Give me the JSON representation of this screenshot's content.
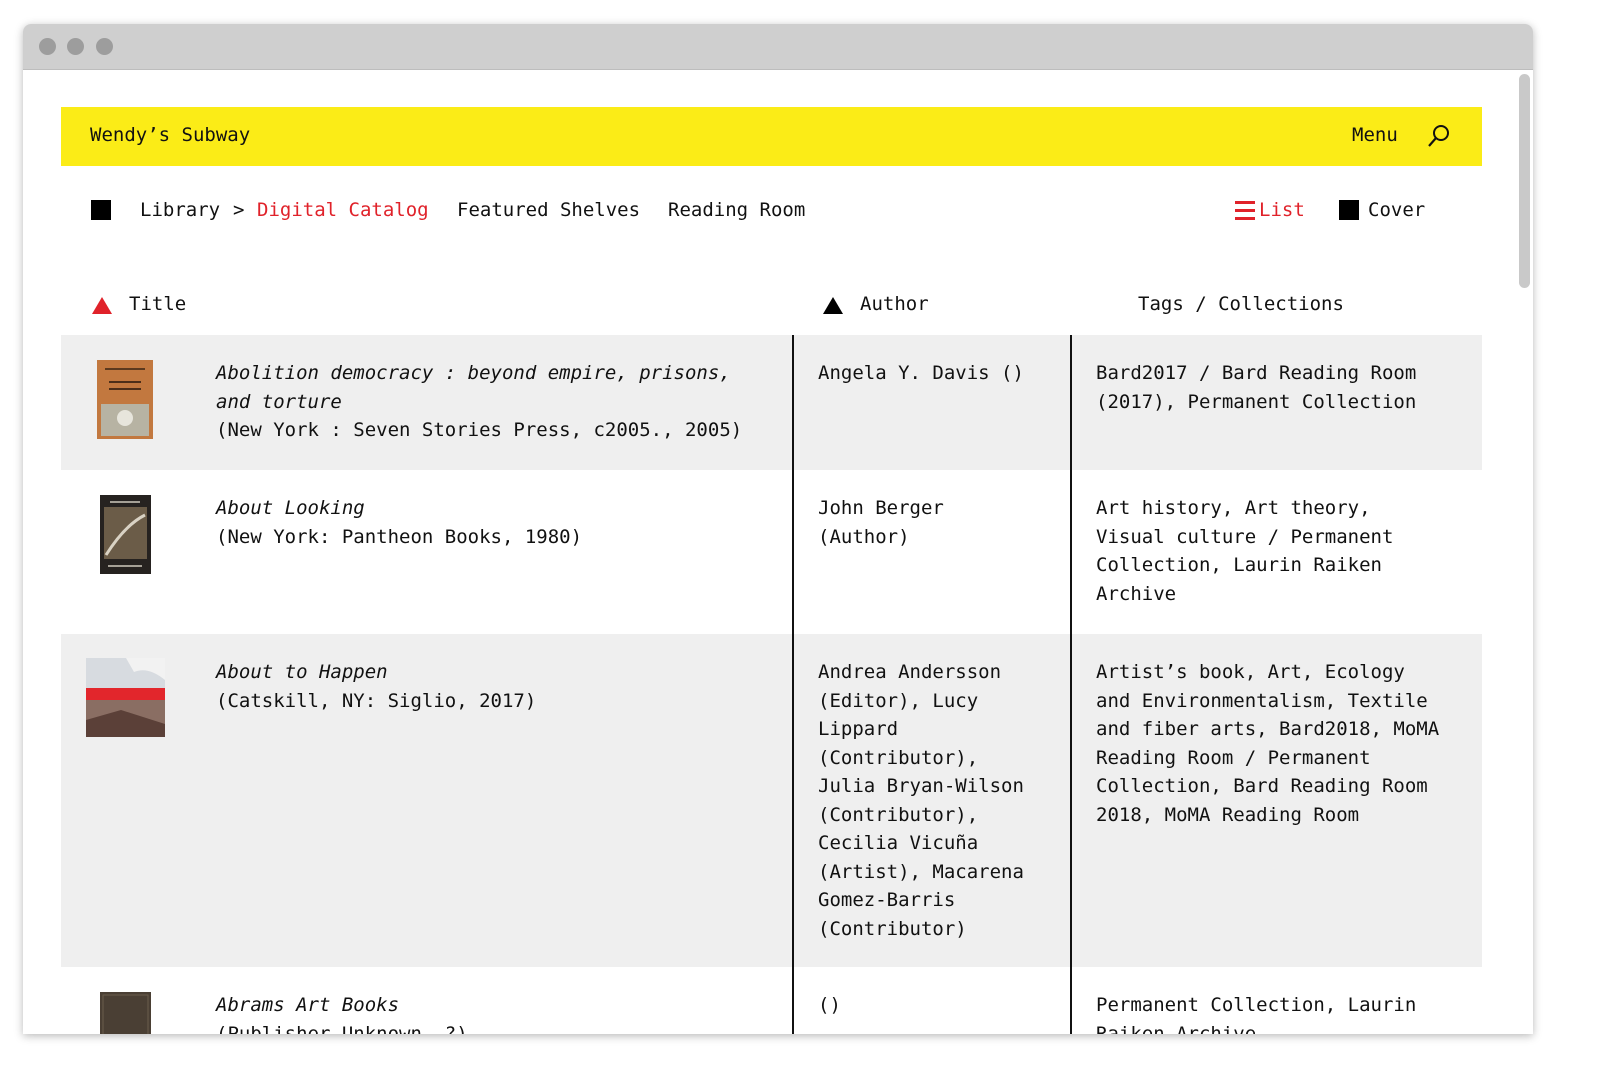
{
  "header": {
    "brand": "Wendy’s Subway",
    "menu_label": "Menu",
    "search_icon": "search-icon",
    "background": "#fbec17"
  },
  "nav": {
    "home_icon": "square-icon",
    "library": "Library",
    "separator": ">",
    "current": "Digital Catalog",
    "featured": "Featured Shelves",
    "reading_room": "Reading Room",
    "view_list_icon": "list-icon",
    "view_list": "List",
    "view_cover_icon": "square-icon",
    "view_cover": "Cover",
    "accent": "#e0222a"
  },
  "columns": {
    "title": "Title",
    "author": "Author",
    "tags": "Tags / Collections",
    "sort_icon": "triangle-up-icon"
  },
  "rows": [
    {
      "title_lines": [
        "Abolition democracy : beyond empire, prisons,",
        "and torture"
      ],
      "pub": "(New York : Seven Stories Press, c2005., 2005)",
      "author_lines": [
        "Angela Y. Davis ()"
      ],
      "tags_lines": [
        "Bard2017 / Bard Reading Room",
        "(2017), Permanent Collection"
      ],
      "cover_text": "ANGELA Y. DAVIS ABOLITION DEMOCRACY"
    },
    {
      "title_lines": [
        "About Looking"
      ],
      "pub": "(New York: Pantheon Books, 1980)",
      "author_lines": [
        "John Berger",
        "(Author)"
      ],
      "tags_lines": [
        "Art history, Art theory,",
        "Visual culture / Permanent",
        "Collection, Laurin Raiken",
        "Archive"
      ],
      "cover_text": "ABOUT LOOKING"
    },
    {
      "title_lines": [
        "About to Happen"
      ],
      "pub": "(Catskill, NY: Siglio, 2017)",
      "author_lines": [
        "Andrea Andersson",
        "(Editor), Lucy",
        "Lippard",
        "(Contributor),",
        "Julia Bryan-Wilson",
        "(Contributor),",
        "Cecilia Vicuña",
        "(Artist), Macarena",
        "Gomez-Barris",
        "(Contributor)"
      ],
      "tags_lines": [
        "Artist’s book, Art, Ecology",
        "and Environmentalism, Textile",
        "and fiber arts, Bard2018, MoMA",
        "Reading Room / Permanent",
        "Collection, Bard Reading Room",
        "2018, MoMA Reading Room"
      ]
    },
    {
      "title_lines": [
        "Abrams Art Books"
      ],
      "pub": "(Publisher Unknown, ?)",
      "author_lines": [
        "()"
      ],
      "tags_lines": [
        "Permanent Collection, Laurin",
        "Raiken Archive"
      ]
    }
  ]
}
